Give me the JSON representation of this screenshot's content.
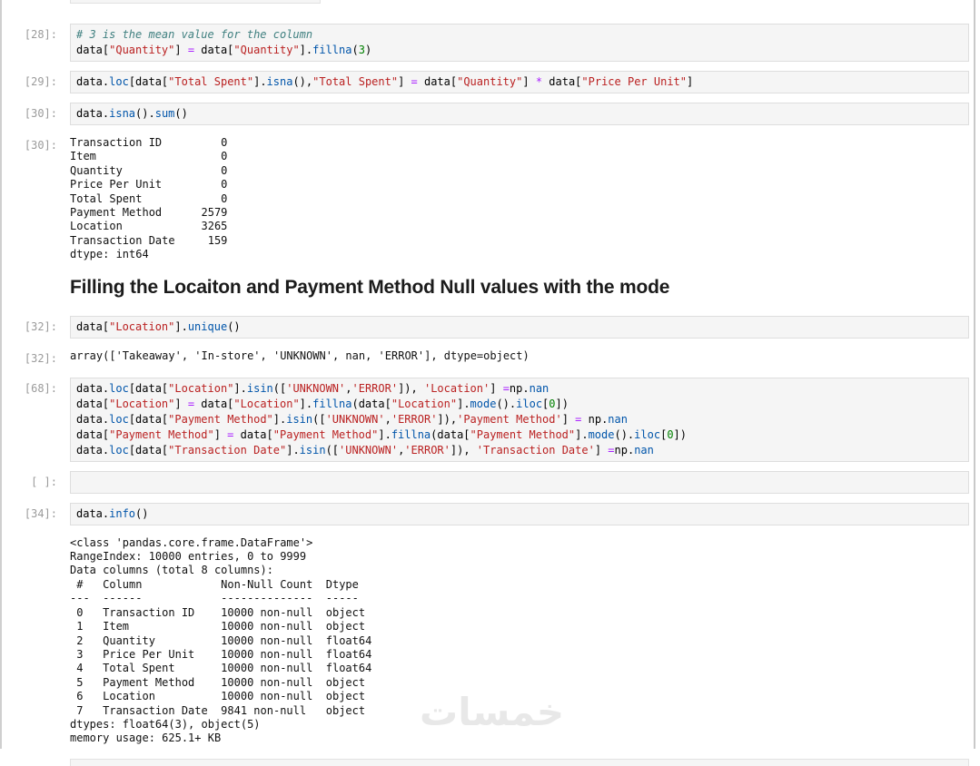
{
  "watermark": "خمسات",
  "colors": {
    "string": "#ba2121",
    "method": "#0055aa",
    "operator": "#aa22ff",
    "number": "#008000",
    "comment": "#408080",
    "prompt": "#9b9b9b",
    "cell_background": "#f5f5f5",
    "cell_border": "#dedede",
    "heading_text": "#1b1b1b",
    "watermark_text": "#e8e8e8"
  },
  "heading": "Filling the Locaiton and Payment Method Null values with the mode",
  "cells": [
    {
      "kind": "stub",
      "cls": "stub-top",
      "name": "partial-cell-top"
    },
    {
      "kind": "code",
      "prompt": "[28]:",
      "lines": [
        [
          [
            "# 3 is the mean value for the column",
            "c"
          ]
        ],
        [
          [
            "data[",
            ""
          ],
          [
            "\"Quantity\"",
            "s"
          ],
          [
            "] ",
            ""
          ],
          [
            "=",
            "o"
          ],
          [
            " data[",
            ""
          ],
          [
            "\"Quantity\"",
            "s"
          ],
          [
            "].",
            ""
          ],
          [
            "fillna",
            "p"
          ],
          [
            "(",
            ""
          ],
          [
            "3",
            "n"
          ],
          [
            ")",
            ""
          ]
        ]
      ]
    },
    {
      "kind": "code",
      "prompt": "[29]:",
      "lines": [
        [
          [
            "data.",
            ""
          ],
          [
            "loc",
            "p"
          ],
          [
            "[data[",
            ""
          ],
          [
            "\"Total Spent\"",
            "s"
          ],
          [
            "].",
            ""
          ],
          [
            "isna",
            "p"
          ],
          [
            "(),",
            ""
          ],
          [
            "\"Total Spent\"",
            "s"
          ],
          [
            "] ",
            ""
          ],
          [
            "=",
            "o"
          ],
          [
            " data[",
            ""
          ],
          [
            "\"Quantity\"",
            "s"
          ],
          [
            "] ",
            ""
          ],
          [
            "*",
            "o"
          ],
          [
            " data[",
            ""
          ],
          [
            "\"Price Per Unit\"",
            "s"
          ],
          [
            "]",
            ""
          ]
        ]
      ]
    },
    {
      "kind": "code",
      "prompt": "[30]:",
      "lines": [
        [
          [
            "data.",
            ""
          ],
          [
            "isna",
            "p"
          ],
          [
            "().",
            ""
          ],
          [
            "sum",
            "p"
          ],
          [
            "()",
            ""
          ]
        ]
      ]
    },
    {
      "kind": "output",
      "prompt": "[30]:",
      "text": "Transaction ID         0\nItem                   0\nQuantity               0\nPrice Per Unit         0\nTotal Spent            0\nPayment Method      2579\nLocation            3265\nTransaction Date     159\ndtype: int64"
    },
    {
      "kind": "heading",
      "text": "Filling the Locaiton and Payment Method Null values with the mode"
    },
    {
      "kind": "code",
      "prompt": "[32]:",
      "lines": [
        [
          [
            "data[",
            ""
          ],
          [
            "\"Location\"",
            "s"
          ],
          [
            "].",
            ""
          ],
          [
            "unique",
            "p"
          ],
          [
            "()",
            ""
          ]
        ]
      ]
    },
    {
      "kind": "output",
      "prompt": "[32]:",
      "text": "array(['Takeaway', 'In-store', 'UNKNOWN', nan, 'ERROR'], dtype=object)"
    },
    {
      "kind": "code",
      "prompt": "[68]:",
      "lines": [
        [
          [
            "data.",
            ""
          ],
          [
            "loc",
            "p"
          ],
          [
            "[data[",
            ""
          ],
          [
            "\"Location\"",
            "s"
          ],
          [
            "].",
            ""
          ],
          [
            "isin",
            "p"
          ],
          [
            "([",
            ""
          ],
          [
            "'UNKNOWN'",
            "s"
          ],
          [
            ",",
            ""
          ],
          [
            "'ERROR'",
            "s"
          ],
          [
            "]), ",
            ""
          ],
          [
            "'Location'",
            "s"
          ],
          [
            "] ",
            ""
          ],
          [
            "=",
            "o"
          ],
          [
            "np.",
            ""
          ],
          [
            "nan",
            "p"
          ]
        ],
        [
          [
            "data[",
            ""
          ],
          [
            "\"Location\"",
            "s"
          ],
          [
            "] ",
            ""
          ],
          [
            "=",
            "o"
          ],
          [
            " data[",
            ""
          ],
          [
            "\"Location\"",
            "s"
          ],
          [
            "].",
            ""
          ],
          [
            "fillna",
            "p"
          ],
          [
            "(data[",
            ""
          ],
          [
            "\"Location\"",
            "s"
          ],
          [
            "].",
            ""
          ],
          [
            "mode",
            "p"
          ],
          [
            "().",
            ""
          ],
          [
            "iloc",
            "p"
          ],
          [
            "[",
            ""
          ],
          [
            "0",
            "n"
          ],
          [
            "])",
            ""
          ]
        ],
        [
          [
            "data.",
            ""
          ],
          [
            "loc",
            "p"
          ],
          [
            "[data[",
            ""
          ],
          [
            "\"Payment Method\"",
            "s"
          ],
          [
            "].",
            ""
          ],
          [
            "isin",
            "p"
          ],
          [
            "([",
            ""
          ],
          [
            "'UNKNOWN'",
            "s"
          ],
          [
            ",",
            ""
          ],
          [
            "'ERROR'",
            "s"
          ],
          [
            "]),",
            ""
          ],
          [
            "'Payment Method'",
            "s"
          ],
          [
            "] ",
            ""
          ],
          [
            "=",
            "o"
          ],
          [
            " np.",
            ""
          ],
          [
            "nan",
            "p"
          ]
        ],
        [
          [
            "data[",
            ""
          ],
          [
            "\"Payment Method\"",
            "s"
          ],
          [
            "] ",
            ""
          ],
          [
            "=",
            "o"
          ],
          [
            " data[",
            ""
          ],
          [
            "\"Payment Method\"",
            "s"
          ],
          [
            "].",
            ""
          ],
          [
            "fillna",
            "p"
          ],
          [
            "(data[",
            ""
          ],
          [
            "\"Payment Method\"",
            "s"
          ],
          [
            "].",
            ""
          ],
          [
            "mode",
            "p"
          ],
          [
            "().",
            ""
          ],
          [
            "iloc",
            "p"
          ],
          [
            "[",
            ""
          ],
          [
            "0",
            "n"
          ],
          [
            "])",
            ""
          ]
        ],
        [
          [
            "data.",
            ""
          ],
          [
            "loc",
            "p"
          ],
          [
            "[data[",
            ""
          ],
          [
            "\"Transaction Date\"",
            "s"
          ],
          [
            "].",
            ""
          ],
          [
            "isin",
            "p"
          ],
          [
            "([",
            ""
          ],
          [
            "'UNKNOWN'",
            "s"
          ],
          [
            ",",
            ""
          ],
          [
            "'ERROR'",
            "s"
          ],
          [
            "]), ",
            ""
          ],
          [
            "'Transaction Date'",
            "s"
          ],
          [
            "] ",
            ""
          ],
          [
            "=",
            "o"
          ],
          [
            "np.",
            ""
          ],
          [
            "nan",
            "p"
          ]
        ]
      ]
    },
    {
      "kind": "code",
      "prompt": "[ ]:",
      "lines": [
        []
      ]
    },
    {
      "kind": "code",
      "prompt": "[34]:",
      "lines": [
        [
          [
            "data.",
            ""
          ],
          [
            "info",
            "p"
          ],
          [
            "()",
            ""
          ]
        ]
      ]
    },
    {
      "kind": "output",
      "prompt": "",
      "text": "<class 'pandas.core.frame.DataFrame'>\nRangeIndex: 10000 entries, 0 to 9999\nData columns (total 8 columns):\n #   Column            Non-Null Count  Dtype  \n---  ------            --------------  -----  \n 0   Transaction ID    10000 non-null  object \n 1   Item              10000 non-null  object \n 2   Quantity          10000 non-null  float64\n 3   Price Per Unit    10000 non-null  float64\n 4   Total Spent       10000 non-null  float64\n 5   Payment Method    10000 non-null  object \n 6   Location          10000 non-null  object \n 7   Transaction Date  9841 non-null   object \ndtypes: float64(3), object(5)\nmemory usage: 625.1+ KB"
    },
    {
      "kind": "stub",
      "cls": "stub-bottom",
      "name": "partial-cell-bottom"
    }
  ]
}
